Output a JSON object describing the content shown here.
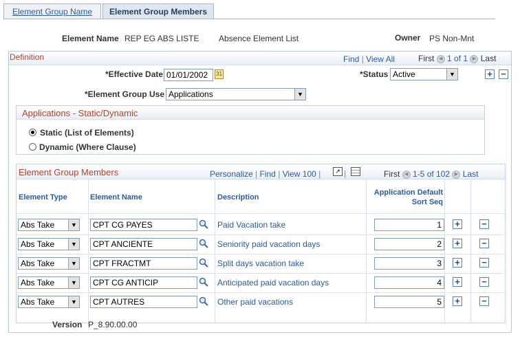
{
  "tabs": [
    {
      "label": "Element Group Name",
      "active": false
    },
    {
      "label": "Element Group Members",
      "active": true
    }
  ],
  "header": {
    "element_name_label": "Element Name",
    "element_name_value": "REP EG ABS LISTE",
    "element_description": "Absence Element List",
    "owner_label": "Owner",
    "owner_value": "PS Non-Mnt"
  },
  "definition": {
    "title": "Definition",
    "nav": {
      "find": "Find",
      "view_all": "View All",
      "first": "First",
      "range": "1 of 1",
      "last": "Last"
    },
    "effective_date_label": "*Effective Date",
    "effective_date_value": "01/01/2002",
    "status_label": "*Status",
    "status_value": "Active",
    "group_use_label": "*Element Group Use",
    "group_use_value": "Applications"
  },
  "static_dynamic": {
    "title": "Applications - Static/Dynamic",
    "option_static": "Static (List of Elements)",
    "option_dynamic": "Dynamic (Where Clause)",
    "selected": "static"
  },
  "members": {
    "title": "Element Group Members",
    "nav": {
      "personalize": "Personalize",
      "find": "Find",
      "view": "View 100",
      "first": "First",
      "range": "1-5 of 102",
      "last": "Last"
    },
    "columns": {
      "element_type": "Element Type",
      "element_name": "Element Name",
      "description": "Description",
      "sort_seq_line1": "Application Default",
      "sort_seq_line2": "Sort Seq"
    },
    "rows": [
      {
        "type": "Abs Take",
        "name": "CPT CG PAYES",
        "description": "Paid Vacation take",
        "seq": "1"
      },
      {
        "type": "Abs Take",
        "name": "CPT ANCIENTE",
        "description": "Seniority paid vacation days",
        "seq": "2"
      },
      {
        "type": "Abs Take",
        "name": "CPT FRACTMT",
        "description": "Split days vacation take",
        "seq": "3"
      },
      {
        "type": "Abs Take",
        "name": "CPT CG ANTICIP",
        "description": "Anticipated paid vacation days",
        "seq": "4"
      },
      {
        "type": "Abs Take",
        "name": "CPT AUTRES",
        "description": "Other paid vacations",
        "seq": "5"
      }
    ]
  },
  "footer": {
    "version_label": "Version",
    "version_value": "P_8.90.00.00"
  },
  "colors": {
    "link": "#2b5aa0",
    "section_title": "#b0442e",
    "border": "#b8c6d6"
  }
}
